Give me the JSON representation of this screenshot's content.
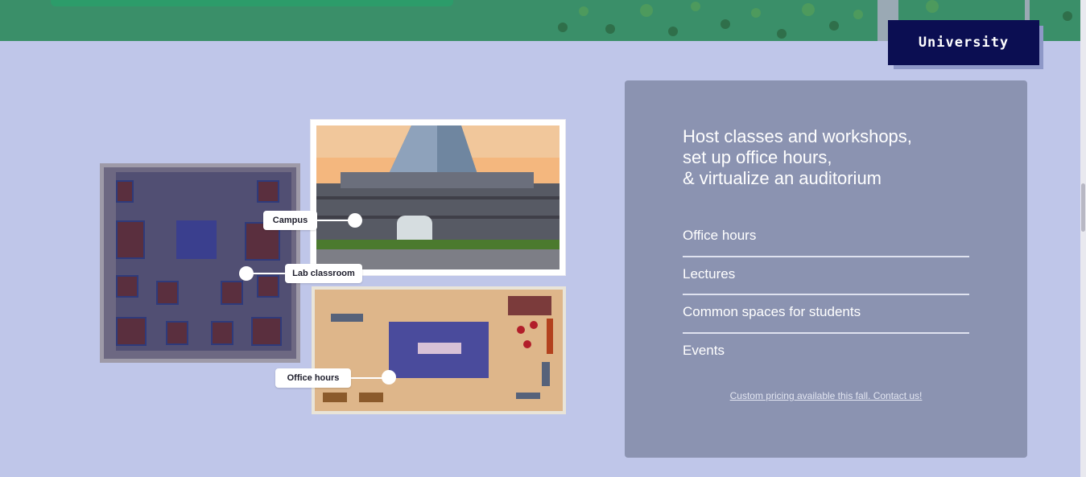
{
  "tab": {
    "label": "University"
  },
  "card": {
    "headline": [
      "Host classes and workshops,",
      "set up office hours,",
      "& virtualize an auditorium"
    ],
    "features": [
      "Office hours",
      "Lectures",
      "Common spaces for students",
      "Events"
    ],
    "pricing_link": "Custom pricing available this fall. Contact us!"
  },
  "maps": {
    "campus_label": "Campus",
    "lab_label": "Lab classroom",
    "office_label": "Office hours"
  },
  "colors": {
    "background": "#bfc6e9",
    "banner_green": "#3a8f69",
    "tab_navy": "#0b0e52",
    "card": "#8b93b1"
  }
}
